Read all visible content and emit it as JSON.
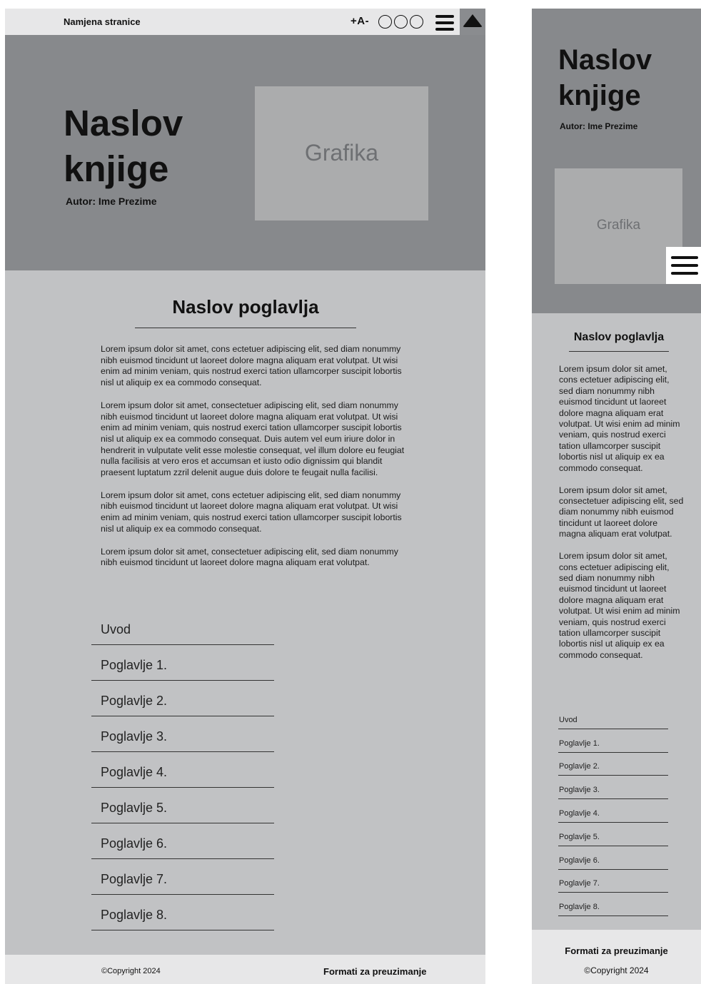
{
  "site_purpose": "Namjena stranice",
  "font_controls": "+A-",
  "book": {
    "title": "Naslov knjige",
    "author": "Autor: Ime Prezime",
    "graphic_label": "Grafika"
  },
  "chapter": {
    "title": "Naslov poglavlja",
    "desktop_paragraphs": [
      "Lorem ipsum dolor sit amet, cons ectetuer adipiscing elit, sed diam nonummy nibh euismod tincidunt ut laoreet dolore magna aliquam erat volutpat. Ut wisi enim ad minim veniam, quis nostrud exerci tation ullamcorper suscipit lobortis nisl ut aliquip ex ea commodo consequat.",
      "Lorem ipsum dolor sit amet, consectetuer adipiscing elit, sed diam nonummy nibh euismod tincidunt ut laoreet dolore magna aliquam erat volutpat. Ut wisi enim ad minim veniam, quis nostrud exerci tation ullamcorper suscipit lobortis nisl ut aliquip ex ea commodo consequat. Duis autem vel eum iriure dolor in hendrerit in vulputate velit esse molestie consequat, vel illum dolore eu feugiat nulla facilisis at vero eros et accumsan et iusto odio dignissim qui blandit praesent luptatum zzril delenit augue duis dolore te feugait nulla facilisi.",
      "Lorem ipsum dolor sit amet, cons ectetuer adipiscing elit, sed diam nonummy nibh euismod tincidunt ut laoreet dolore magna aliquam erat volutpat. Ut wisi enim ad minim veniam, quis nostrud exerci tation ullamcorper suscipit lobortis nisl ut aliquip ex ea commodo consequat.",
      "Lorem ipsum dolor sit amet, consectetuer adipiscing elit, sed diam nonummy nibh euismod tincidunt ut laoreet dolore magna aliquam erat volutpat."
    ],
    "mobile_paragraphs": [
      "Lorem ipsum dolor sit amet, cons ectetuer adipiscing elit, sed diam nonummy nibh euismod tincidunt ut laoreet dolore magna aliquam erat volutpat. Ut wisi enim ad minim veniam, quis nostrud exerci tation ullamcorper suscipit lobortis nisl ut aliquip ex ea commodo consequat.",
      "Lorem ipsum dolor sit amet, consectetuer adipiscing elit, sed diam nonummy nibh euismod tincidunt ut laoreet dolore magna aliquam erat volutpat.",
      "Lorem ipsum dolor sit amet, cons ectetuer adipiscing elit, sed diam nonummy nibh euismod tincidunt ut laoreet dolore magna aliquam erat volutpat. Ut wisi enim ad minim veniam, quis nostrud exerci tation ullamcorper suscipit lobortis nisl ut aliquip ex ea commodo consequat."
    ]
  },
  "toc": [
    "Uvod",
    "Poglavlje 1.",
    "Poglavlje 2.",
    "Poglavlje 3.",
    "Poglavlje 4.",
    "Poglavlje 5.",
    "Poglavlje 6.",
    "Poglavlje 7.",
    "Poglavlje 8."
  ],
  "footer": {
    "copyright": "©Copyright 2024",
    "formats": "Formati za preuzimanje"
  },
  "icons": {
    "theme_options": "circle-icon",
    "menu": "hamburger-menu-icon",
    "back_to_top": "triangle-up-icon"
  },
  "colors": {
    "topbar": "#e7e7e8",
    "hero": "#87898c",
    "content": "#c1c2c4",
    "graphic": "#abacad"
  }
}
